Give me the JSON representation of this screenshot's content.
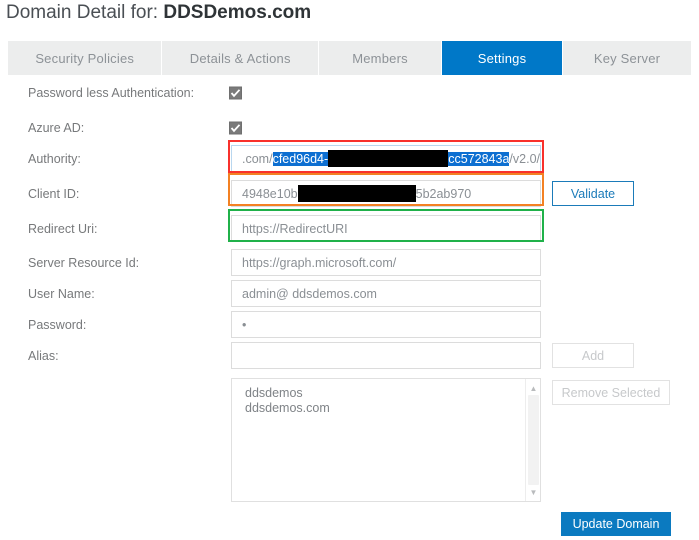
{
  "header": {
    "title_prefix": "Domain Detail for:",
    "domain": "DDSDemos.com"
  },
  "tabs": [
    {
      "label": "Security Policies",
      "active": false
    },
    {
      "label": "Details & Actions",
      "active": false
    },
    {
      "label": "Members",
      "active": false
    },
    {
      "label": "Settings",
      "active": true
    },
    {
      "label": "Key Server",
      "active": false
    }
  ],
  "form": {
    "passwordless": {
      "label": "Password less Authentication:",
      "checked": true
    },
    "azure_ad": {
      "label": "Azure AD:",
      "checked": true
    },
    "authority": {
      "label": "Authority:",
      "value_visible_prefix": ".com/",
      "value_selected_start": "cfed96d4-",
      "value_redacted": true,
      "value_selected_end": "cc572843a",
      "value_suffix": "/v2.0/",
      "highlight_color": "#f8312c"
    },
    "client_id": {
      "label": "Client ID:",
      "value_prefix": "4948e10b",
      "value_redacted": true,
      "value_suffix": "5b2ab970",
      "highlight_color": "#f38123"
    },
    "redirect_uri": {
      "label": "Redirect Uri:",
      "value": "https://RedirectURI",
      "highlight_color": "#20b14a"
    },
    "server_resource_id": {
      "label": "Server Resource Id:",
      "value": "https://graph.microsoft.com/"
    },
    "user_name": {
      "label": "User Name:",
      "value": "admin@ ddsdemos.com"
    },
    "password": {
      "label": "Password:",
      "value": "•"
    },
    "alias": {
      "label": "Alias:",
      "value": "",
      "placeholder": ""
    }
  },
  "buttons": {
    "validate": "Validate",
    "add": "Add",
    "remove_selected": "Remove Selected",
    "update_domain": "Update Domain"
  },
  "alias_list": {
    "items": [
      "ddsdemos",
      "ddsdemos.com"
    ]
  },
  "colors": {
    "accent_blue": "#0078c8",
    "primary_button": "#0b7ac0",
    "selection_blue": "#0d6fd1",
    "highlight_red": "#f8312c",
    "highlight_orange": "#f38123",
    "highlight_green": "#20b14a"
  }
}
